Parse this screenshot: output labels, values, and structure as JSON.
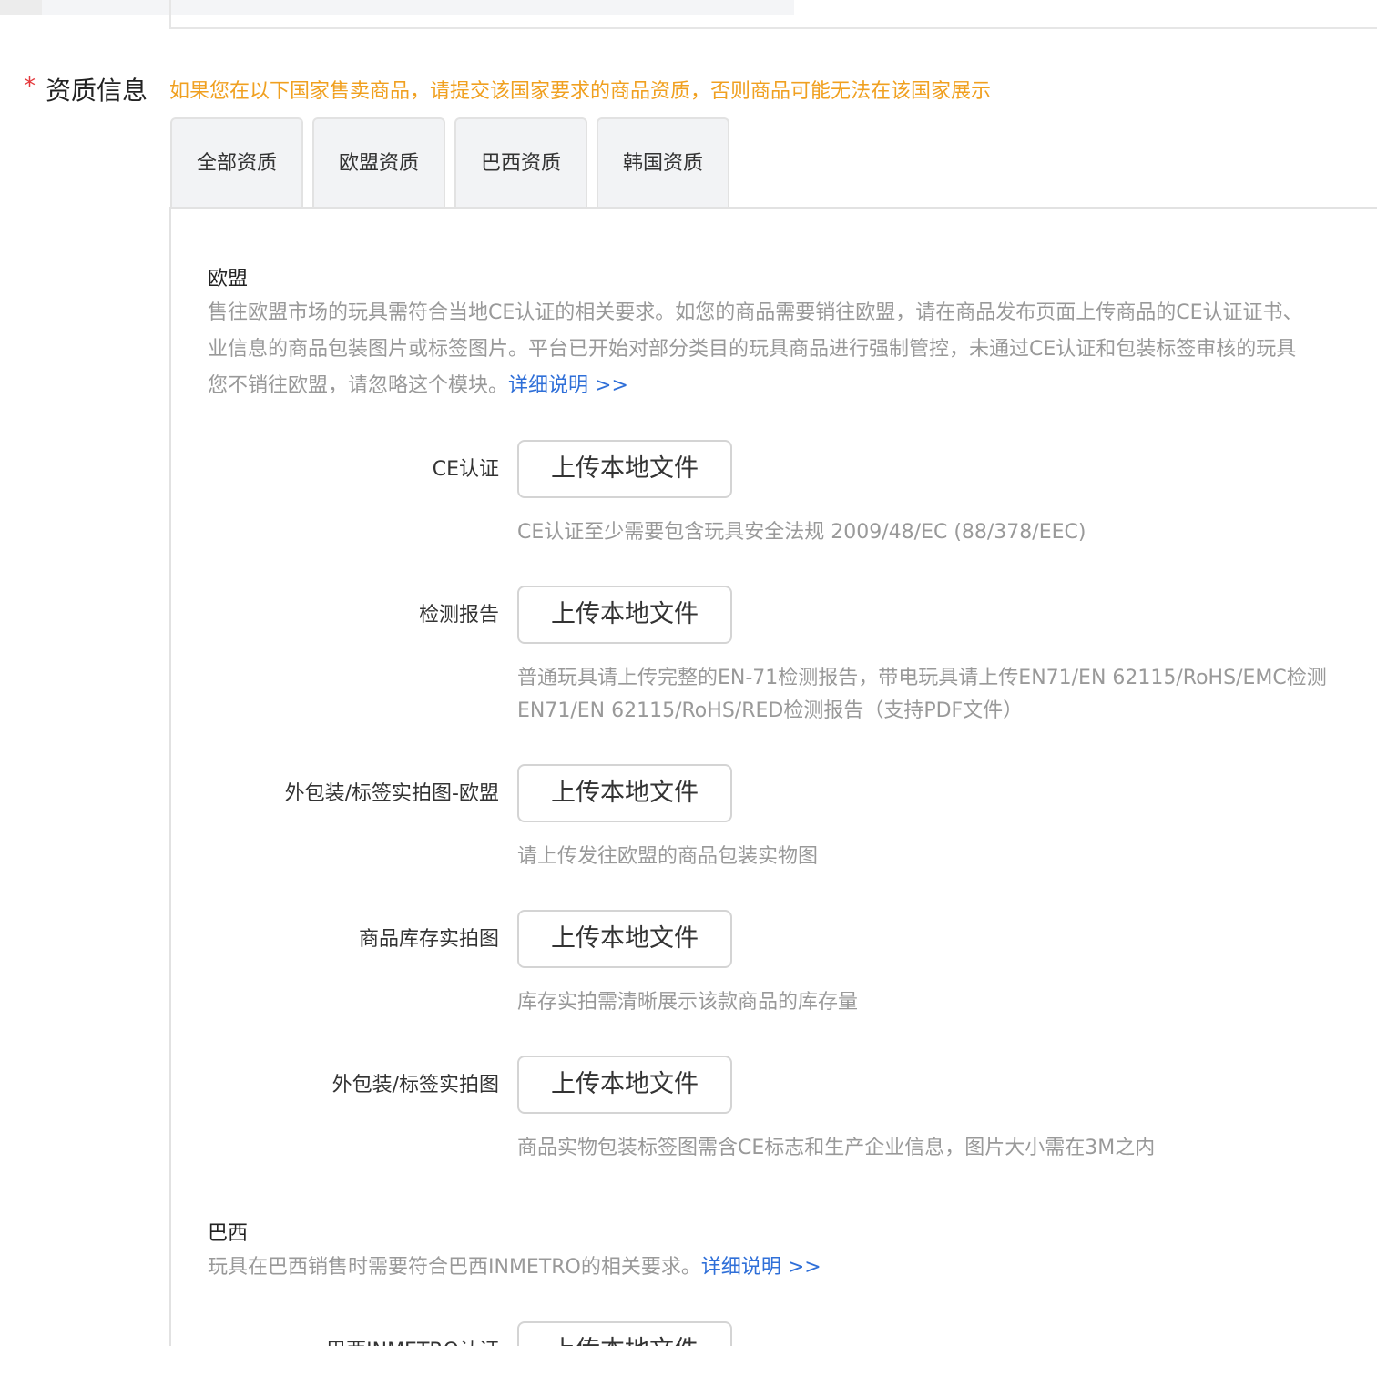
{
  "section": {
    "required_mark": "*",
    "title": "资质信息",
    "notice": "如果您在以下国家售卖商品，请提交该国家要求的商品资质，否则商品可能无法在该国家展示"
  },
  "tabs": [
    {
      "label": "全部资质"
    },
    {
      "label": "欧盟资质"
    },
    {
      "label": "巴西资质"
    },
    {
      "label": "韩国资质"
    }
  ],
  "eu": {
    "title": "欧盟",
    "desc_line1": "售往欧盟市场的玩具需符合当地CE认证的相关要求。如您的商品需要销往欧盟，请在商品发布页面上传商品的CE认证证书、",
    "desc_line2": "业信息的商品包装图片或标签图片。平台已开始对部分类目的玩具商品进行强制管控，未通过CE认证和包装标签审核的玩具",
    "desc_line3": "您不销往欧盟，请忽略这个模块。",
    "detail_link": "详细说明 >>",
    "fields": [
      {
        "label": "CE认证",
        "button": "上传本地文件",
        "hint": "CE认证至少需要包含玩具安全法规 2009/48/EC (88/378/EEC)"
      },
      {
        "label": "检测报告",
        "button": "上传本地文件",
        "hint": "普通玩具请上传完整的EN-71检测报告，带电玩具请上传EN71/EN 62115/RoHS/EMC检测",
        "hint2": "EN71/EN 62115/RoHS/RED检测报告（支持PDF文件）"
      },
      {
        "label": "外包装/标签实拍图-欧盟",
        "button": "上传本地文件",
        "hint": "请上传发往欧盟的商品包装实物图"
      },
      {
        "label": "商品库存实拍图",
        "button": "上传本地文件",
        "hint": "库存实拍需清晰展示该款商品的库存量"
      },
      {
        "label": "外包装/标签实拍图",
        "button": "上传本地文件",
        "hint": "商品实物包装标签图需含CE标志和生产企业信息，图片大小需在3M之内"
      }
    ]
  },
  "brazil": {
    "title": "巴西",
    "desc": "玩具在巴西销售时需要符合巴西INMETRO的相关要求。",
    "detail_link": "详细说明 >>",
    "fields": [
      {
        "label": "巴西INMETRO认证",
        "button": "上传本地文件"
      }
    ]
  }
}
